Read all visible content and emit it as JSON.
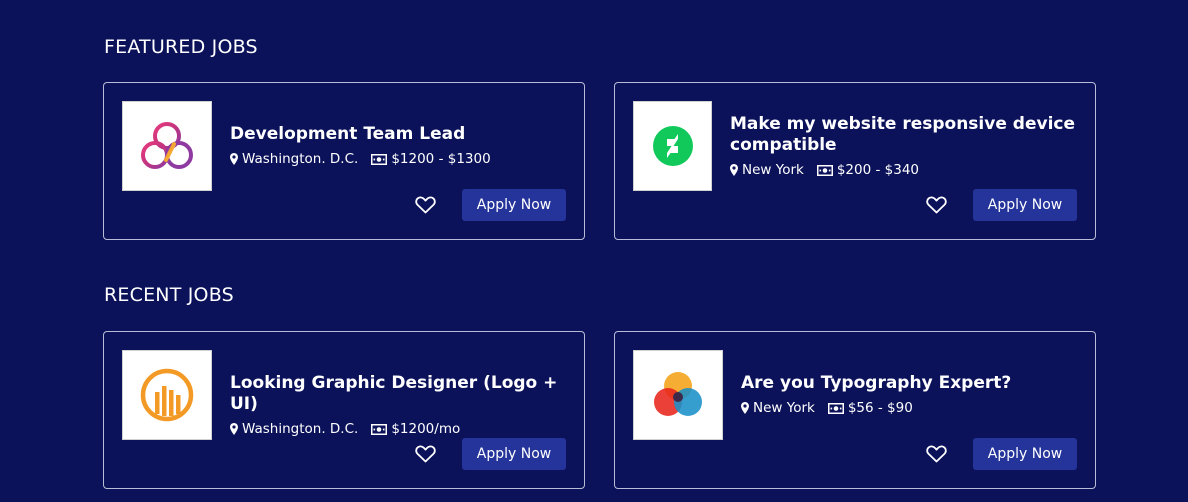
{
  "featured": {
    "heading": "FEATURED JOBS",
    "jobs": [
      {
        "title": "Development Team Lead",
        "location": "Washington. D.C.",
        "salary": "$1200 - $1300",
        "logo": "trefoil-rings-logo",
        "apply_label": "Apply Now"
      },
      {
        "title": "Make my website responsive device compatible",
        "location": "New York",
        "salary": "$200 - $340",
        "logo": "deviantart-green-logo",
        "apply_label": "Apply Now"
      }
    ]
  },
  "recent": {
    "heading": "RECENT JOBS",
    "jobs": [
      {
        "title": "Looking Graphic Designer (Logo + UI)",
        "location": "Washington. D.C.",
        "salary": "$1200/mo",
        "logo": "orange-bars-circle-logo",
        "apply_label": "Apply Now"
      },
      {
        "title": "Are you Typography Expert?",
        "location": "New York",
        "salary": "$56 - $90",
        "logo": "overlapping-circles-logo",
        "apply_label": "Apply Now"
      }
    ]
  },
  "colors": {
    "background": "#0b125a",
    "button": "#25349a",
    "card_border": "#b9bcd7"
  }
}
